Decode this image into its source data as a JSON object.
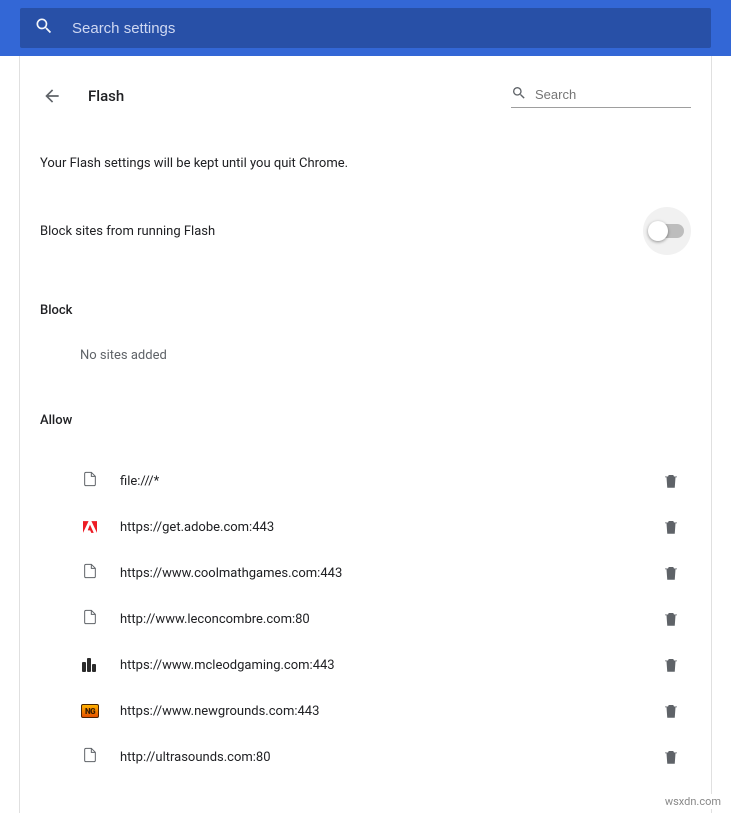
{
  "top_search": {
    "placeholder": "Search settings"
  },
  "header": {
    "title": "Flash",
    "search_placeholder": "Search"
  },
  "info": "Your Flash settings will be kept until you quit Chrome.",
  "toggle": {
    "label": "Block sites from running Flash",
    "on": false
  },
  "block_section": {
    "title": "Block",
    "empty": "No sites added",
    "sites": []
  },
  "allow_section": {
    "title": "Allow",
    "sites": [
      {
        "url": "file:///*",
        "icon": "file"
      },
      {
        "url": "https://get.adobe.com:443",
        "icon": "adobe"
      },
      {
        "url": "https://www.coolmathgames.com:443",
        "icon": "file"
      },
      {
        "url": "http://www.leconcombre.com:80",
        "icon": "file"
      },
      {
        "url": "https://www.mcleodgaming.com:443",
        "icon": "mcleodgaming"
      },
      {
        "url": "https://www.newgrounds.com:443",
        "icon": "newgrounds"
      },
      {
        "url": "http://ultrasounds.com:80",
        "icon": "file"
      }
    ]
  },
  "watermark": "wsxdn.com"
}
